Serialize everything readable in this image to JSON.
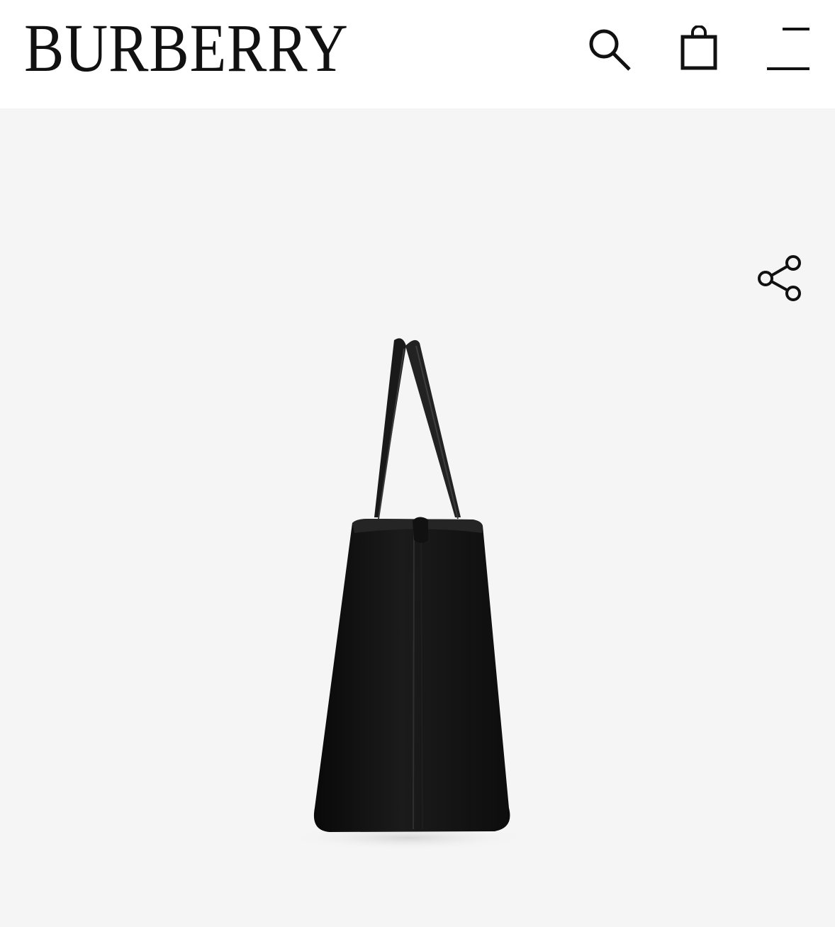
{
  "header": {
    "logo_text": "BURBERRY",
    "icons": {
      "search": "search-icon",
      "bag": "shopping-bag-icon",
      "menu": "menu-icon"
    }
  },
  "product": {
    "image": "black-leather-tote-bag-side-view",
    "share_icon": "share-icon"
  },
  "colors": {
    "header_bg": "#ffffff",
    "image_bg": "#f5f5f5",
    "text": "#111111",
    "bag": "#151515"
  }
}
